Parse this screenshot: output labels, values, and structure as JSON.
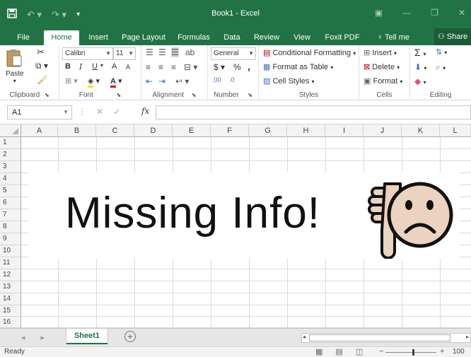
{
  "window": {
    "title": "Book1  -  Excel"
  },
  "ribbon_tabs": [
    "File",
    "Home",
    "Insert",
    "Page Layout",
    "Formulas",
    "Data",
    "Review",
    "View",
    "Foxit PDF",
    "Tell me"
  ],
  "active_tab": "Home",
  "share_label": "Share",
  "clipboard": {
    "paste_label": "Paste",
    "group_label": "Clipboard"
  },
  "font": {
    "name": "Calibri",
    "size": "11",
    "bold": "B",
    "italic": "I",
    "underline": "U",
    "grow": "A",
    "shrink": "A",
    "group_label": "Font"
  },
  "alignment": {
    "group_label": "Alignment"
  },
  "number": {
    "format": "General",
    "currency": "$",
    "percent": "%",
    "comma": ",",
    "inc_decimal": ".00",
    "dec_decimal": ".0",
    "group_label": "Number"
  },
  "styles": {
    "conditional": "Conditional Formatting",
    "format_table": "Format as Table",
    "cell_styles": "Cell Styles",
    "group_label": "Styles"
  },
  "cells": {
    "insert": "Insert",
    "delete": "Delete",
    "format": "Format",
    "group_label": "Cells"
  },
  "editing": {
    "group_label": "Editing"
  },
  "formula_bar": {
    "name_box": "A1",
    "fx": "fx",
    "value": ""
  },
  "columns": [
    "A",
    "B",
    "C",
    "D",
    "E",
    "F",
    "G",
    "H",
    "I",
    "J",
    "K",
    "L"
  ],
  "rows": [
    "1",
    "2",
    "3",
    "4",
    "5",
    "6",
    "7",
    "8",
    "9",
    "10",
    "11",
    "12",
    "13",
    "14",
    "15",
    "16"
  ],
  "overlay_text": "Missing Info!",
  "sheet_tabs": [
    "Sheet1"
  ],
  "status": {
    "ready": "Ready",
    "zoom": "100"
  },
  "colors": {
    "excel_green": "#217346",
    "face_fill": "#ebd3bf",
    "outline": "#111111"
  },
  "icons": {
    "overlay": "sad-face-thumbs-down-icon"
  }
}
